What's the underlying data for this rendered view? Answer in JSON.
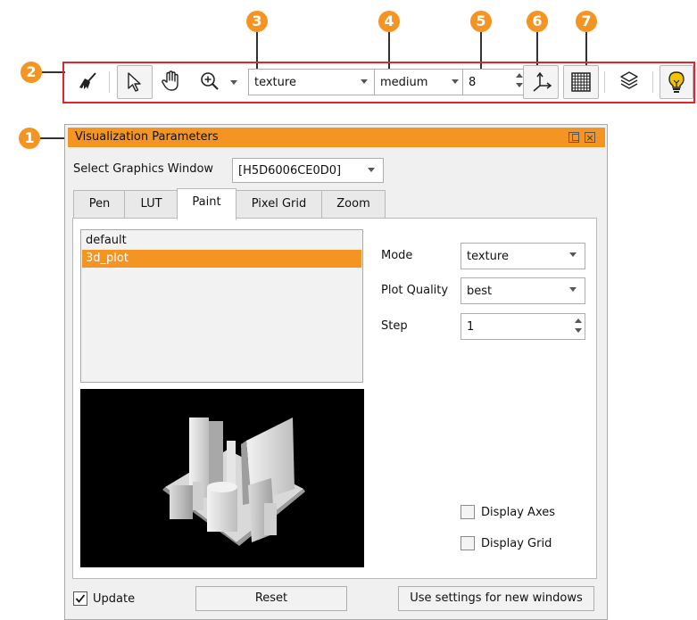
{
  "callouts": [
    "1",
    "2",
    "3",
    "4",
    "5",
    "6",
    "7"
  ],
  "toolbar": {
    "mode_value": "texture",
    "quality_value": "medium",
    "step_value": "8"
  },
  "panel": {
    "title": "Visualization Parameters",
    "select_window_label": "Select Graphics Window",
    "select_window_value": "[H5D6006CE0D0]",
    "tabs": [
      "Pen",
      "LUT",
      "Paint",
      "Pixel Grid",
      "Zoom"
    ],
    "active_tab": "Paint",
    "list_items": [
      "default",
      "3d_plot"
    ],
    "selected_item": "3d_plot",
    "mode_label": "Mode",
    "mode_value": "texture",
    "quality_label": "Plot Quality",
    "quality_value": "best",
    "step_label": "Step",
    "step_value": "1",
    "display_axes": "Display Axes",
    "display_grid": "Display Grid",
    "update_label": "Update",
    "reset_label": "Reset",
    "use_settings_label": "Use settings for new windows"
  },
  "colors": {
    "accent": "#f39423",
    "highlight_frame": "#e3242b"
  }
}
